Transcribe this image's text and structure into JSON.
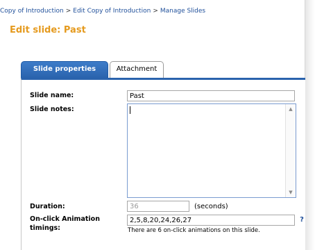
{
  "breadcrumb": {
    "items": [
      "Copy of Introduction",
      "Edit Copy of Introduction",
      "Manage Slides"
    ],
    "separator": ">"
  },
  "page": {
    "title": "Edit slide: Past"
  },
  "tabs": [
    {
      "label": "Slide properties",
      "active": true
    },
    {
      "label": "Attachment",
      "active": false
    }
  ],
  "form": {
    "slide_name_label": "Slide name:",
    "slide_name_value": "Past",
    "slide_notes_label": "Slide notes:",
    "slide_notes_value": "",
    "duration_label": "Duration:",
    "duration_value": "36",
    "duration_unit": "(seconds)",
    "animation_label_line1": "On-click Animation",
    "animation_label_line2": "timings:",
    "animation_value": "2,5,8,20,24,26,27",
    "animation_note": "There are 6 on-click animations on this slide.",
    "help_symbol": "?"
  },
  "icons": {
    "scroll_up": "scroll-up-arrow-icon",
    "scroll_down": "scroll-down-arrow-icon",
    "help": "help-icon"
  },
  "colors": {
    "title": "#e59a1e",
    "link": "#1f4f9a",
    "tab_active": "#2a63ad"
  }
}
